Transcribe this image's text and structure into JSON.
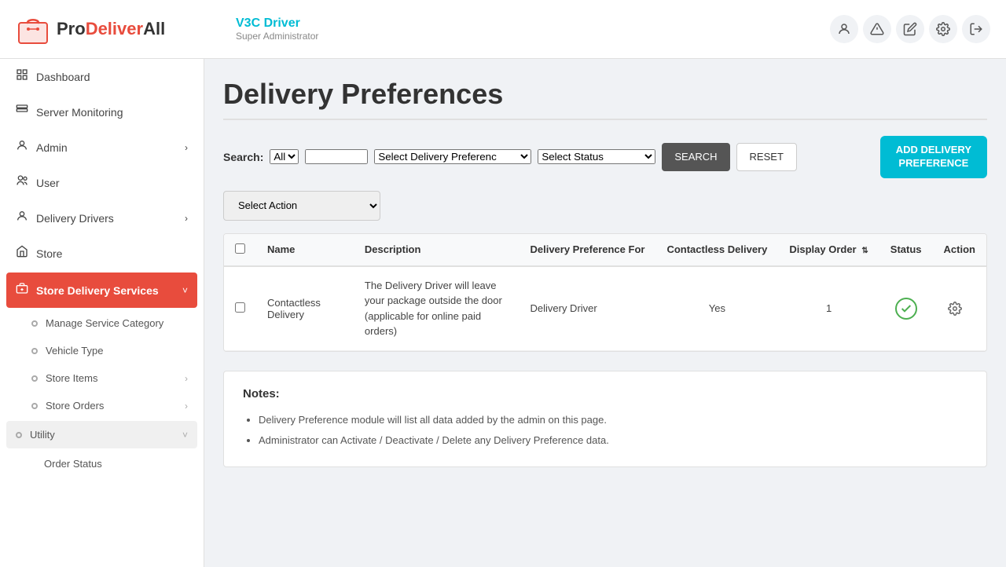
{
  "header": {
    "title": "V3C Driver",
    "subtitle": "Super Administrator",
    "logo_pro": "Pro",
    "logo_deliver": "Deliver",
    "logo_all": "All"
  },
  "sidebar": {
    "items": [
      {
        "id": "dashboard",
        "label": "Dashboard",
        "icon": "⊞",
        "active": false
      },
      {
        "id": "server-monitoring",
        "label": "Server Monitoring",
        "icon": "📊",
        "active": false
      },
      {
        "id": "admin",
        "label": "Admin",
        "icon": "👤",
        "active": false,
        "has_chevron": true
      },
      {
        "id": "user",
        "label": "User",
        "icon": "👥",
        "active": false
      },
      {
        "id": "delivery-drivers",
        "label": "Delivery Drivers",
        "icon": "🚗",
        "active": false,
        "has_chevron": true
      },
      {
        "id": "store",
        "label": "Store",
        "icon": "🏪",
        "active": false
      },
      {
        "id": "store-delivery-services",
        "label": "Store Delivery Services",
        "icon": "📦",
        "active": true,
        "has_chevron": true
      },
      {
        "id": "manage-service-category",
        "label": "Manage Service Category",
        "icon": "",
        "sub": true
      },
      {
        "id": "vehicle-type",
        "label": "Vehicle Type",
        "icon": "",
        "sub": true
      },
      {
        "id": "store-items",
        "label": "Store Items",
        "icon": "",
        "sub": true,
        "has_chevron": true
      },
      {
        "id": "store-orders",
        "label": "Store Orders",
        "icon": "",
        "sub": true,
        "has_chevron": true
      },
      {
        "id": "utility",
        "label": "Utility",
        "icon": "",
        "sub": true,
        "has_chevron": true
      },
      {
        "id": "order-status",
        "label": "Order Status",
        "icon": "",
        "sub2": true
      }
    ]
  },
  "page": {
    "title": "Delivery Preferences",
    "search_label": "Search:",
    "search_all_option": "All",
    "search_placeholder": "",
    "delivery_preference_placeholder": "Select Delivery Preferenc",
    "status_placeholder": "Select Status",
    "btn_search": "SEARCH",
    "btn_reset": "RESET",
    "btn_add": "ADD DELIVERY\nPREFERENCE",
    "action_placeholder": "Select Action"
  },
  "table": {
    "columns": [
      {
        "id": "checkbox",
        "label": ""
      },
      {
        "id": "name",
        "label": "Name"
      },
      {
        "id": "description",
        "label": "Description"
      },
      {
        "id": "delivery_preference_for",
        "label": "Delivery Preference For"
      },
      {
        "id": "contactless_delivery",
        "label": "Contactless Delivery"
      },
      {
        "id": "display_order",
        "label": "Display Order"
      },
      {
        "id": "status",
        "label": "Status"
      },
      {
        "id": "action",
        "label": "Action"
      }
    ],
    "rows": [
      {
        "name": "Contactless Delivery",
        "description": "The Delivery Driver will leave your package outside the door (applicable for online paid orders)",
        "delivery_preference_for": "Delivery Driver",
        "contactless_delivery": "Yes",
        "display_order": "1",
        "status": "active"
      }
    ]
  },
  "notes": {
    "title": "Notes:",
    "items": [
      "Delivery Preference module will list all data added by the admin on this page.",
      "Administrator can Activate / Deactivate / Delete any Delivery Preference data."
    ]
  }
}
